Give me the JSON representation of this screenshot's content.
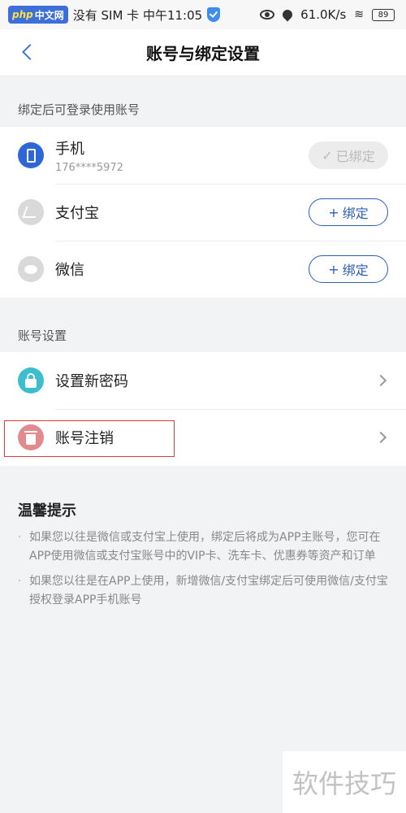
{
  "status_bar": {
    "carrier": "没有 SIM 卡 中午11:05",
    "logo_text": "php",
    "logo_cn": "中文网",
    "net_speed": "61.0K/s",
    "battery": "89"
  },
  "nav": {
    "title": "账号与绑定设置"
  },
  "section_bind": {
    "header": "绑定后可登录使用账号",
    "phone": {
      "label": "手机",
      "number": "176****5972",
      "status": "已绑定"
    },
    "alipay": {
      "label": "支付宝",
      "button": "绑定"
    },
    "wechat": {
      "label": "微信",
      "button": "绑定"
    }
  },
  "section_account": {
    "header": "账号设置",
    "set_password": "设置新密码",
    "delete_account": "账号注销"
  },
  "tips": {
    "title": "温馨提示",
    "items": [
      "如果您以往是微信或支付宝上使用，绑定后将成为APP主账号，您可在APP使用微信或支付宝账号中的VIP卡、洗车卡、优惠券等资产和订单",
      "如果您以往是在APP上使用，新增微信/支付宝绑定后可使用微信/支付宝授权登录APP手机账号"
    ]
  },
  "watermark": "软件技巧",
  "colors": {
    "accent": "#2d5fb8",
    "back_arrow": "#3a7ad8",
    "highlight": "#e23b3b"
  }
}
